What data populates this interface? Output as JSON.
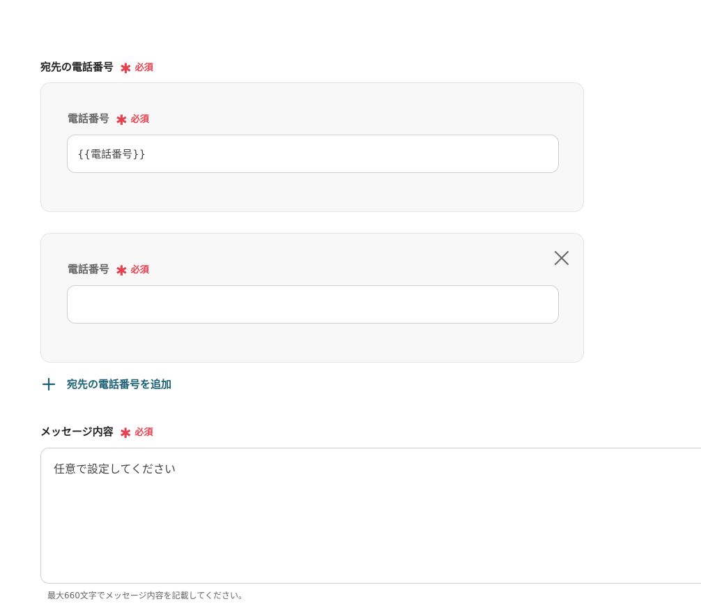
{
  "recipient_section": {
    "label": "宛先の電話番号",
    "required_mark": "✱",
    "required_text": "必須"
  },
  "phone_entries": [
    {
      "label": "電話番号",
      "required_mark": "✱",
      "required_text": "必須",
      "value": "{{電話番号}}",
      "removable": false
    },
    {
      "label": "電話番号",
      "required_mark": "✱",
      "required_text": "必須",
      "value": "",
      "removable": true
    }
  ],
  "add_recipient": {
    "label": "宛先の電話番号を追加",
    "icon": "plus-icon"
  },
  "message_section": {
    "label": "メッセージ内容",
    "required_mark": "✱",
    "required_text": "必須",
    "placeholder": "任意で設定してください",
    "value": "",
    "help": "最大660文字でメッセージ内容を記載してください。"
  },
  "colors": {
    "required": "#e5414e",
    "link": "#1a5f73",
    "card_bg": "#f8f8f8",
    "border": "#cfcfcf"
  }
}
